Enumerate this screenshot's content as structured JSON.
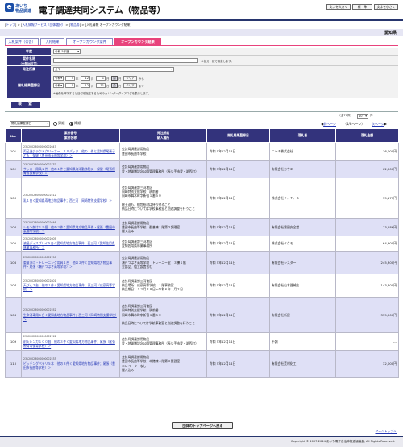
{
  "header": {
    "logo_mark": "e",
    "logo_line1": "あいち",
    "logo_line2": "物品調達",
    "system_title": "電子調達共同システム（物品等）",
    "font_large_label": "文字を大きく",
    "font_standard_label": "標　準",
    "font_small_label": "文字を小さく"
  },
  "breadcrumb": {
    "top": "トップ",
    "service": "入札情報サービス（団体選択）",
    "goods": "物品等",
    "current": "入札情報 オープンカウンタ結果"
  },
  "region": "愛知県",
  "tabs": [
    {
      "label": "入札案件（公告）",
      "active": false
    },
    {
      "label": "入札結果",
      "active": false
    },
    {
      "label": "オープンカウンタ案件",
      "active": false
    },
    {
      "label": "オープンカウンタ結果",
      "active": true
    }
  ],
  "search_form": {
    "fiscal_year_label": "年度",
    "fiscal_year_value": "令和 5年度",
    "case_name_label": "案件名称",
    "case_name_sub": "（全角50文字）",
    "case_name_value": "",
    "case_name_note": "※部分一致で検索します。",
    "dept_label": "発注所属",
    "dept_value": "全て",
    "date_label": "開札結果登録日",
    "from_era": "令和",
    "from_year": "5",
    "from_month": "12",
    "from_day": "1",
    "to_era": "令和",
    "to_year": "5",
    "to_month": "12",
    "to_day": "31",
    "unit_year": "年",
    "unit_month": "月",
    "unit_day": "日",
    "calendar_label": "曲",
    "clear_label": "クリア",
    "from_suffix": "から",
    "to_suffix": "まで",
    "date_note": "※画像を押下すると日付を指定するためのカレンダーダイアログを表示します。",
    "search_button": "検　索"
  },
  "results_controls": {
    "sort_value": "開札結果登録日",
    "asc_label": "昇順",
    "desc_label": "降順",
    "count_label": "表示件数",
    "count_value": "10",
    "count_unit": "件",
    "total_label": "（全77件）",
    "prev_label": "前ページ",
    "page_info": "（1/8ページ）",
    "next_label": "次ページ"
  },
  "table": {
    "headers": {
      "no": "No.",
      "case_line1": "案件番号",
      "case_line2": "案件名称",
      "dept_line1": "発注所属",
      "dept_line2": "納入場所",
      "date": "開札結果登録日",
      "winner": "落札者",
      "amount": "落札金額"
    },
    "rows": [
      {
        "no": "101",
        "id": "23120023000000002647",
        "name": "両足進グラウドクリーナー　１０パック　他の１件と愛知県尾張子ども・保健（豊田市長曲等学校）＞",
        "dept": "会計局調達課用物品\n豊田市長曲等学校",
        "date": "令和 5年12月14日",
        "winner": "ニシキ株式会社",
        "amount": "16,000円"
      },
      {
        "no": "102",
        "id": "23120023000000002732",
        "name": "サッカー用具２件　他の１件と愛知県海洋勤務防災・保健（尾張療育等保育学校）＞",
        "dept": "会計局調達課用物品\n愛・地球博記念公園管理事務所（長久手市愛・湖西町）",
        "date": "令和 5年12月14日",
        "winner": "有限会社カサエ",
        "amount": "62,000円"
      },
      {
        "no": "103",
        "id": "23120023000000002512",
        "name": "乳１台く愛知県寿地方物品事件；西三河（岡崎特別支援学校）＞",
        "dept": "会計局調達課三河地区\n岡崎特別支援学校　耕前番\n岡崎市舞木町字新宿１番５０\n\n総土送も、梱包紙材は持ち帰ること\n納品日時については学校事務室と別途調整を行うこと",
        "date": "令和 5年12月14日",
        "winner": "株式会社Ｙ．Ｔ．Ｓ",
        "amount": "35,177円"
      },
      {
        "no": "104",
        "id": "23120023000000002646",
        "name": "レモン前け１５個　他の２件く愛知県地方物品事件・尾張（豊田市長曲等学校）＞",
        "dept": "会計局調達課用物品\n豊田市長曲等学校　郡基棟１階第２調理室\n搬入込み",
        "date": "令和 5年12月14日",
        "winner": "有限会社霧田安全堂",
        "amount": "73,286円"
      },
      {
        "no": "105",
        "id": "23120023000000002605",
        "name": "液晶ディスプレイ５台く愛知県地方物品事件；西三河（愛知佐用県林業事務所）＞",
        "dept": "会計局調達課三河地区\n愛知佐用県林業事務所",
        "date": "令和 5年12月14日",
        "winner": "株式会社イクモ",
        "amount": "64,900円"
      },
      {
        "no": "106",
        "id": "23120023000000002700",
        "name": "重量あげ・トレーニング用具１台　他の２件く愛知県地方物品事件・尾張（瀬戸つばさ高等学校）＞",
        "dept": "会計局調達課用物品\n瀬戸つばさ高等学校　トレーニー室　３棟１階\n全部品、組立設置含む",
        "date": "令和 5年12月14日",
        "winner": "有限会社シスター",
        "amount": "245,300円"
      },
      {
        "no": "107",
        "id": "23120023000000002801",
        "name": "天びん２台　他の１件く愛知県地方物品事件；東三河（成豪高等学校）＞",
        "dept": "会計局調達課三河地区\n納品場所：成豪高等学校　１階事務室\n納品期日：１２月２８日～令和６年１月２日",
        "date": "令和 5年12月14日",
        "winner": "有限会社山本器械店",
        "amount": "143,800円"
      },
      {
        "no": "108",
        "id": "23120023000000002552",
        "name": "生命消毒用１台く愛知県地方物品事件；西三河（岡崎特別支援学校）＞",
        "dept": "会計局調達課三河地区\n岡崎特別支援学校　耕前番\n岡崎市舞木町字新宿１番５０\n\n納品日時については学校事務室と別途調整を行うこと",
        "date": "令和 5年12月14日",
        "winner": "有限会社新屋",
        "amount": "335,000円"
      },
      {
        "no": "109",
        "id": "23120023000000002742",
        "name": "耐火レンガ１００個　他の３件く愛知県地方物品事件；尾張（尾張療育等保育学校）＞",
        "dept": "会計局調達課用物品\n愛・地球博記念公園管理事務所（長久手市愛・湖西町）",
        "date": "令和 5年12月14日",
        "winner": "不調",
        "amount": "---"
      },
      {
        "no": "110",
        "id": "23120023000000002533",
        "name": "ピッチングバテリ５本　他の３件く愛知県地方物品事件；尾張（豊田市長曲等学校）＞",
        "dept": "会計局調達課用物品\n豊田市長曲等学校　本館棟４階第３実習室\nエレベーターなし\n搬入込み",
        "date": "令和 5年12月14日",
        "winner": "有限会社荒村化工",
        "amount": "32,000円"
      }
    ]
  },
  "bottom": {
    "back_button": "団体のトップページへ戻る",
    "page_top": "ページトップへ"
  },
  "footer": {
    "copyright": "Copyright © 2007-2024 あいち電子自治体推進協議会, All Rights Reserved."
  },
  "colors": {
    "navy": "#33337c",
    "active_tab": "#e8437c",
    "row_alt": "#dfe0f6",
    "link": "#2538b5"
  }
}
